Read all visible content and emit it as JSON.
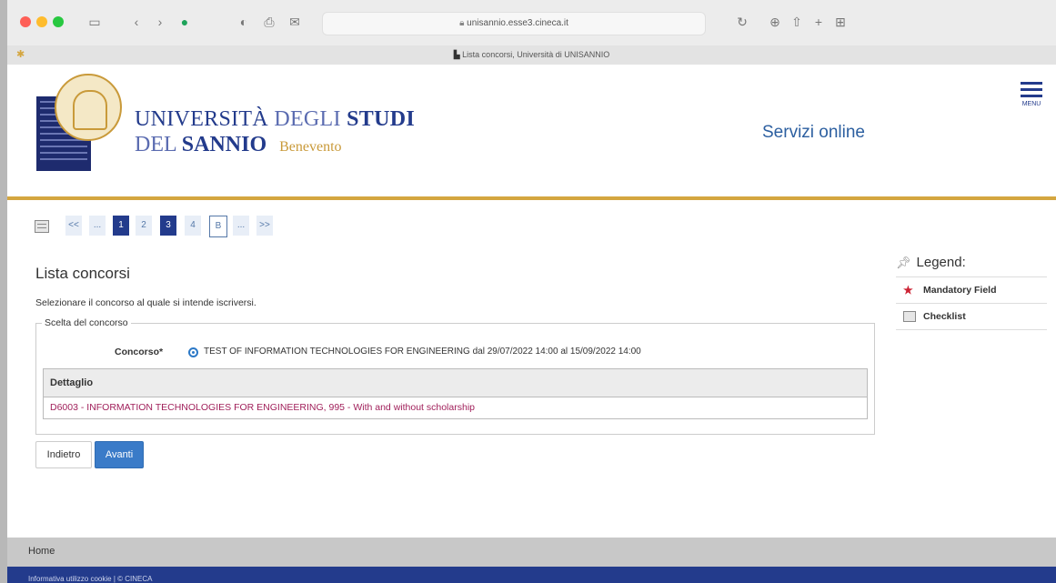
{
  "browser": {
    "url": "unisannio.esse3.cineca.it",
    "tab_title": "Lista concorsi, Università di UNISANNIO"
  },
  "header": {
    "uni_line1_a": "UNIVERSITÀ",
    "uni_line1_b": "DEGLI",
    "uni_line1_c": "STUDI",
    "uni_line2_a": "DEL",
    "uni_line2_b": "SANNIO",
    "uni_line2_city": "Benevento",
    "services": "Servizi online",
    "menu_label": "MENU"
  },
  "pager": {
    "items": [
      "<<",
      "...",
      "1",
      "2",
      "3",
      "4",
      "B",
      "...",
      ">>"
    ]
  },
  "main": {
    "title": "Lista concorsi",
    "instruction": "Selezionare il concorso al quale si intende iscriversi.",
    "fieldset_legend": "Scelta del concorso",
    "concorso_label": "Concorso*",
    "concorso_option": "TEST OF INFORMATION TECHNOLOGIES FOR ENGINEERING dal 29/07/2022 14:00 al 15/09/2022 14:00",
    "detail_header": "Dettaglio",
    "detail_row": "D6003 - INFORMATION TECHNOLOGIES FOR ENGINEERING, 995 - With and without scholarship",
    "back_button": "Indietro",
    "next_button": "Avanti"
  },
  "legend": {
    "title": "Legend:",
    "mandatory": "Mandatory Field",
    "checklist": "Checklist"
  },
  "footer": {
    "home": "Home",
    "bottom": "Informativa utilizzo cookie | © CINECA"
  },
  "colors": {
    "brand_blue": "#233b8c",
    "gold": "#d4a640",
    "link": "#a01f5a",
    "button": "#3a7bc8"
  }
}
